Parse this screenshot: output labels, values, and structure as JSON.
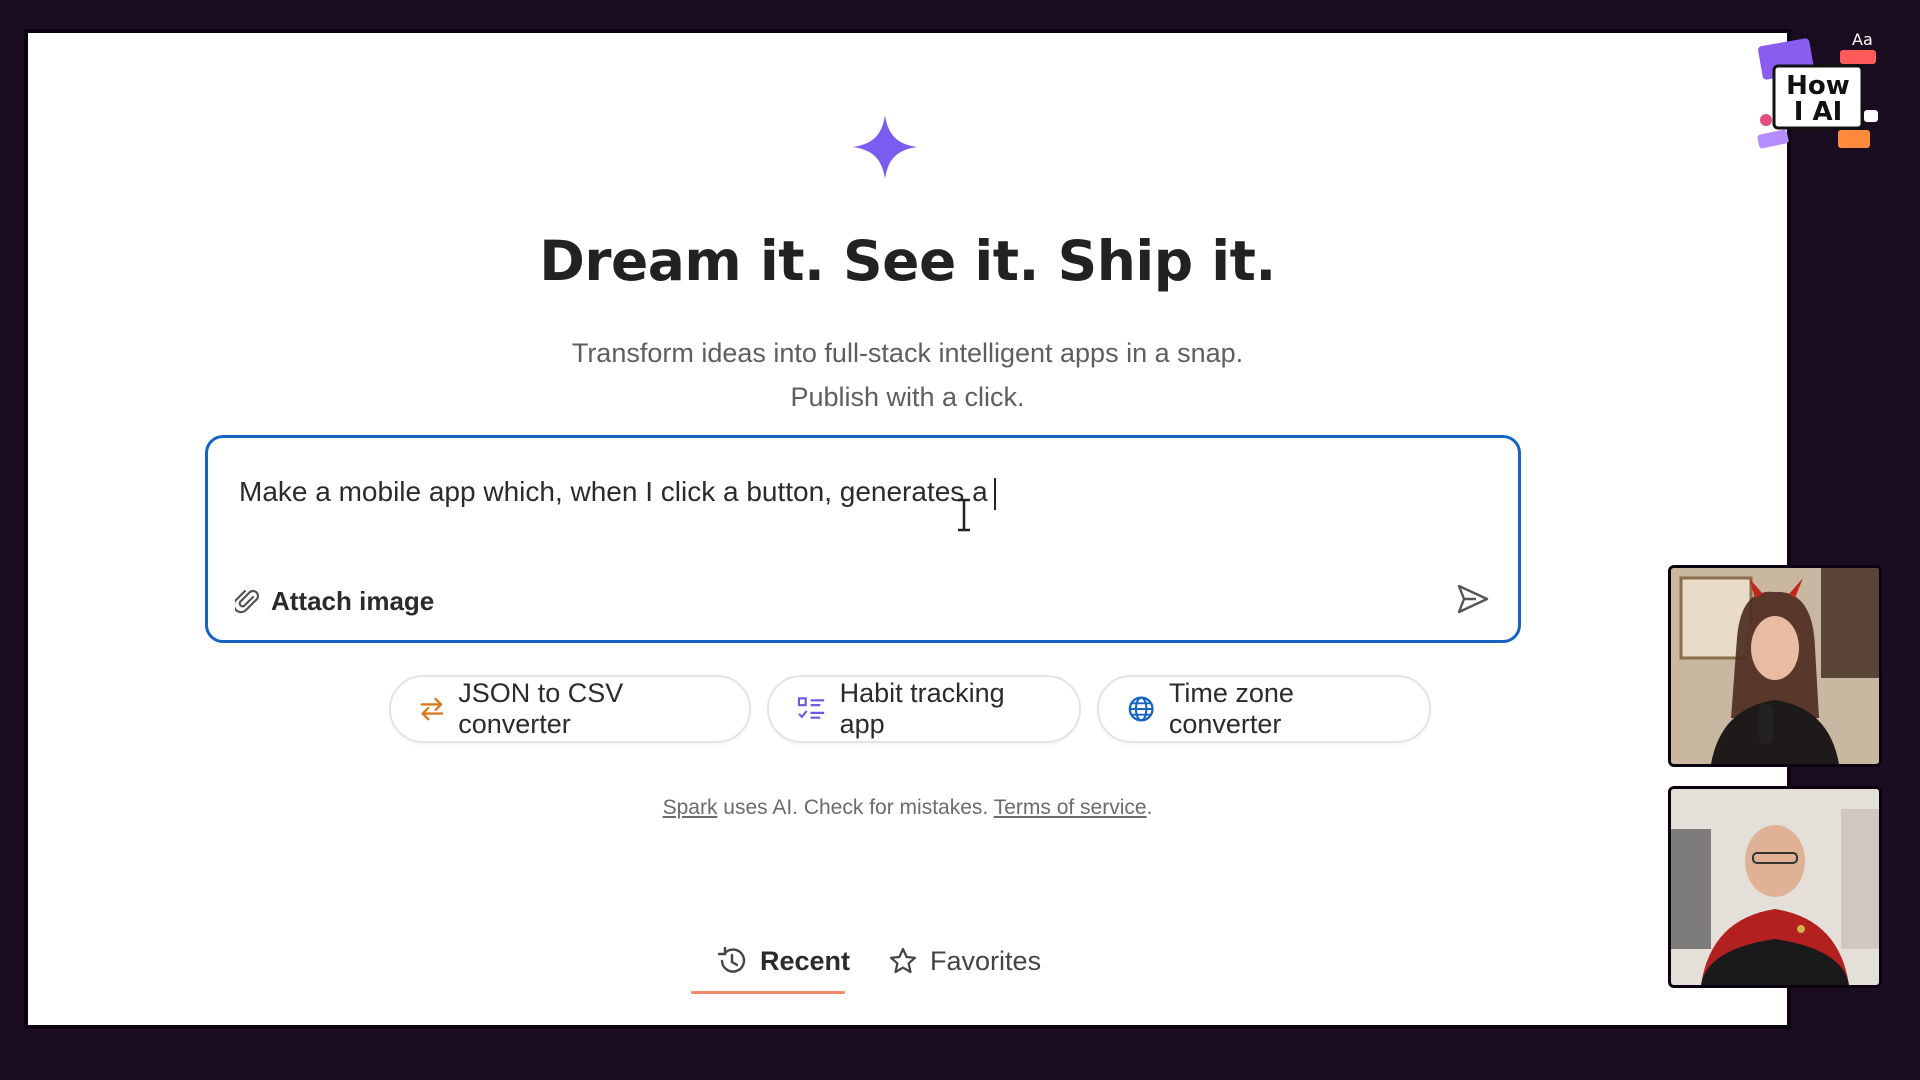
{
  "colors": {
    "accent_blue": "#1565c0",
    "spark_purple": "#7b5cf0",
    "recent_underline": "#f08a6a",
    "outer_background": "#1a0d22"
  },
  "hero": {
    "headline": "Dream it. See it. Ship it.",
    "subline_1": "Transform ideas into full-stack intelligent apps in a snap.",
    "subline_2": "Publish with a click."
  },
  "prompt": {
    "text": "Make a mobile app which, when I click a button, generates a",
    "attach_label": "Attach image"
  },
  "suggestions": [
    {
      "label": "JSON to CSV converter",
      "icon": "swap-arrows-icon"
    },
    {
      "label": "Habit tracking app",
      "icon": "checklist-icon"
    },
    {
      "label": "Time zone converter",
      "icon": "globe-icon"
    }
  ],
  "disclaimer": {
    "spark_link": "Spark",
    "middle": " uses AI. Check for mistakes. ",
    "terms_link": "Terms of service",
    "end": "."
  },
  "tabs": {
    "recent": "Recent",
    "favorites": "Favorites"
  },
  "overlay": {
    "logo_line1": "How",
    "logo_line2": "I AI",
    "logo_aa": "Aa"
  }
}
